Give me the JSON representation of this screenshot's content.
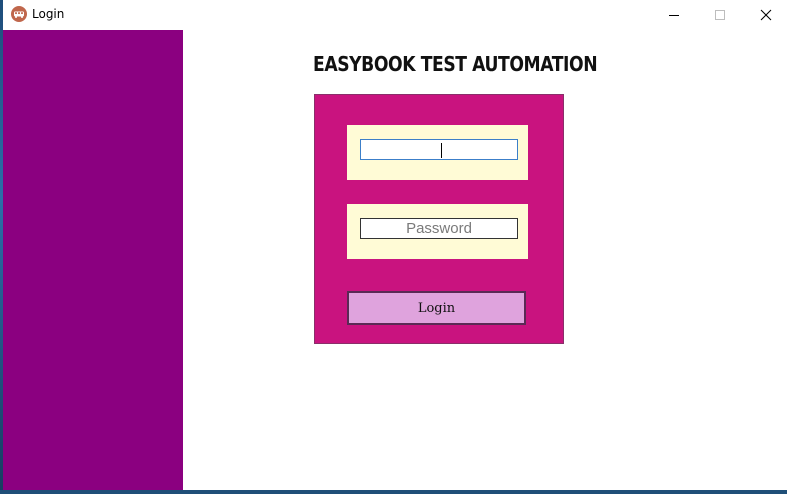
{
  "window": {
    "title": "Login",
    "icon": "bus-app-icon",
    "controls": {
      "minimize": "minimize-icon",
      "maximize": "maximize-icon",
      "close": "close-icon"
    }
  },
  "colors": {
    "sidebar": "#8b0080",
    "panel": "#c9137f",
    "field_background": "#fffbd6",
    "button": "#dfa3dd"
  },
  "main": {
    "heading": "EASYBOOK TEST AUTOMATION",
    "username": {
      "value": "",
      "placeholder": ""
    },
    "password": {
      "value": "",
      "placeholder": "Password"
    },
    "login_button": "Login"
  }
}
